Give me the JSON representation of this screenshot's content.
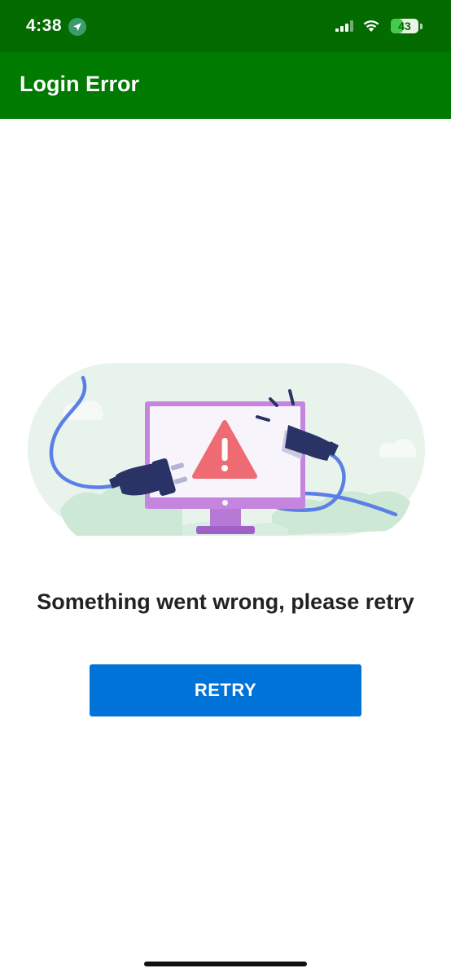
{
  "status_bar": {
    "time": "4:38",
    "battery": "43",
    "battery_level_percent": 43
  },
  "app_bar": {
    "title": "Login Error"
  },
  "illustration": {
    "description_icon": "unplugged-monitor-warning-illustration"
  },
  "error": {
    "message": "Something went wrong, please retry"
  },
  "actions": {
    "retry_label": "RETRY"
  },
  "colors": {
    "status_bar": "#036b00",
    "app_bar": "#007a00",
    "primary_button": "#0073d9",
    "warning": "#ef6b73"
  }
}
